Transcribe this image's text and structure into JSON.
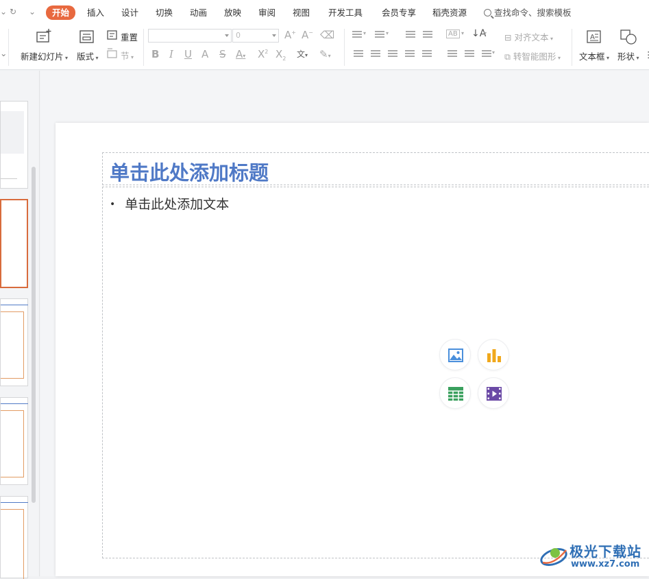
{
  "menu_tabs": [
    {
      "label": "开始",
      "active": true
    },
    {
      "label": "插入"
    },
    {
      "label": "设计"
    },
    {
      "label": "切换"
    },
    {
      "label": "动画"
    },
    {
      "label": "放映"
    },
    {
      "label": "审阅"
    },
    {
      "label": "视图"
    },
    {
      "label": "开发工具"
    },
    {
      "label": "会员专享"
    },
    {
      "label": "稻壳资源"
    }
  ],
  "search": {
    "label": "查找命令、搜索模板"
  },
  "ribbon": {
    "new_slide": "新建幻灯片",
    "layout": "版式",
    "reset": "重置",
    "section": "节",
    "font_size": "0",
    "align_text": "对齐文本",
    "smart_art": "转智能图形",
    "text_box": "文本框",
    "shape": "形状"
  },
  "slide": {
    "title_placeholder": "单击此处添加标题",
    "body_placeholder": "单击此处添加文本",
    "bullet": "•"
  },
  "insert_icons": [
    "picture-icon",
    "chart-icon",
    "table-icon",
    "video-icon"
  ],
  "watermark": {
    "line1": "极光下载站",
    "line2": "www.xz7.com"
  },
  "colors": {
    "accent": "#e8693f",
    "title": "#4f79c6",
    "selection": "#d86b3c"
  }
}
